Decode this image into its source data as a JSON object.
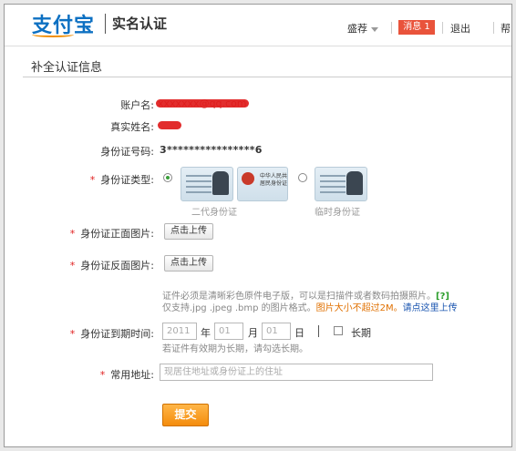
{
  "brand": {
    "logo_text": "支付宝",
    "page_title": "实名认证"
  },
  "topnav": {
    "user": "盛荐",
    "messages_label": "消息",
    "messages_count": "1",
    "logout": "退出",
    "help": "帮"
  },
  "section": {
    "title": "补全认证信息"
  },
  "form": {
    "account_label": "账户名:",
    "account_value": "xxxxxxx@qq.com",
    "realname_label": "真实姓名:",
    "idnum_label": "身份证号码:",
    "idnum_value": "3****************6",
    "idtype_label": "身份证类型:",
    "idtype_options": [
      {
        "caption": "二代身份证",
        "card_title": "中华人民共和国\n居民身份证",
        "selected": true
      },
      {
        "caption": "临时身份证",
        "selected": false
      }
    ],
    "front_label": "身份证正面图片:",
    "back_label": "身份证反面图片:",
    "upload_button": "点击上传",
    "hint_line1": "证件必须是清晰彩色原件电子版，可以是扫描件或者数码拍摄照片。",
    "hint_help": "[?]",
    "hint_line2": "仅支持.jpg .jpeg .bmp 的图片格式。",
    "hint_size": "图片大小不超过2M。",
    "hint_link": "请点这里上传",
    "expiry_label": "身份证到期时间:",
    "expiry_year_placeholder": "2011",
    "expiry_year_unit": "年",
    "expiry_month_placeholder": "01",
    "expiry_month_unit": "月",
    "expiry_day_placeholder": "01",
    "expiry_day_unit": "日",
    "longterm_label": "长期",
    "expiry_hint": "若证件有效期为长期，请勾选长期。",
    "address_label": "常用地址:",
    "address_placeholder": "现居住地址或身份证上的住址",
    "submit": "提交"
  },
  "colors": {
    "brand_blue": "#0d70c2",
    "required_red": "#e02020",
    "submit_orange": "#f48c0c",
    "badge_red": "#e9533b",
    "link_blue": "#1a55b0"
  }
}
